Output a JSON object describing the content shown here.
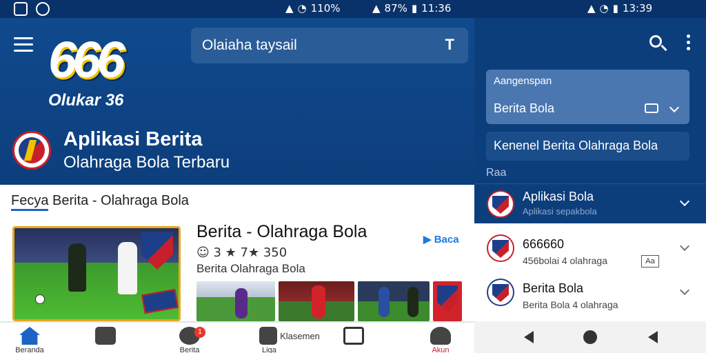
{
  "statusbar": {
    "group1": "110%",
    "group2": "87%",
    "time1": "11:36",
    "time2": "13:39"
  },
  "app": {
    "logo_number": "666",
    "logo_sub": "Olukar 36",
    "search_placeholder": "Olaiaha taysail",
    "hero_title": "Aplikasi Berita",
    "hero_subtitle": "Olahraga Bola Terbaru"
  },
  "content": {
    "breadcrumb_prefix": "Fecya",
    "breadcrumb_text": "Berita - Olahraga Bola",
    "card_title": "Berita - Olahraga Bola",
    "card_meta": "☺ 3 ★ 7★ 350",
    "card_desc": "Berita Olahraga Bola",
    "card_link": "Baca",
    "gallery": [
      "",
      "",
      "",
      ""
    ]
  },
  "bottom_nav": [
    {
      "label": "Beranda",
      "icon": "home-icon"
    },
    {
      "label": "",
      "icon": "shield-icon"
    },
    {
      "label": "Berita",
      "icon": "chat-icon",
      "badge": "1"
    },
    {
      "label": "Liga",
      "icon": "store-icon",
      "extra": "Klasemen"
    },
    {
      "label": "",
      "icon": "square-icon"
    },
    {
      "label": "Akun",
      "icon": "person-icon"
    }
  ],
  "right_panel": {
    "dropdown1_label": "Aangenspan",
    "dropdown1_value": "Berita Bola",
    "dropdown2_value": "Kenenel Berita Olahraga Bola",
    "section_label": "Raa",
    "rows": [
      {
        "title": "Aplikasi Bola",
        "subtitle": "Aplikasi sepakbola"
      },
      {
        "title": "666660",
        "subtitle": "456bolai 4 olahraga",
        "kbd": "Aa"
      },
      {
        "title": "Berita Bola",
        "subtitle": "Berita Bola 4 olahraga"
      }
    ]
  },
  "colors": {
    "primary": "#0d3e7c",
    "accent": "#1d63c4",
    "badge": "#e8382b",
    "highlight": "#e8a818"
  }
}
